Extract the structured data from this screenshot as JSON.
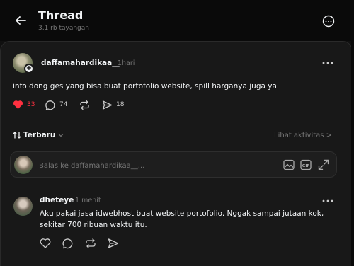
{
  "header": {
    "title": "Thread",
    "views": "3,1 rb tayangan"
  },
  "post": {
    "username": "daffamahardikaa__",
    "time": "1hari",
    "text": "info dong ges yang bisa buat portofolio website, spill harganya juga ya",
    "likes": "33",
    "comments": "74",
    "shares": "18"
  },
  "sort": {
    "label": "Terbaru",
    "activity": "Lihat aktivitas >"
  },
  "reply_box": {
    "placeholder": "Balas ke daffamahardikaa__..."
  },
  "reply": {
    "username": "dheteye",
    "time": "1 menit",
    "text": "Aku pakai jasa idwebhost buat website portofolio. Nggak sampai jutaan kok, sekitar 700 ribuan waktu itu."
  },
  "colors": {
    "background": "#101010",
    "panel": "#181818",
    "like": "#ff3040",
    "muted": "#777777"
  }
}
